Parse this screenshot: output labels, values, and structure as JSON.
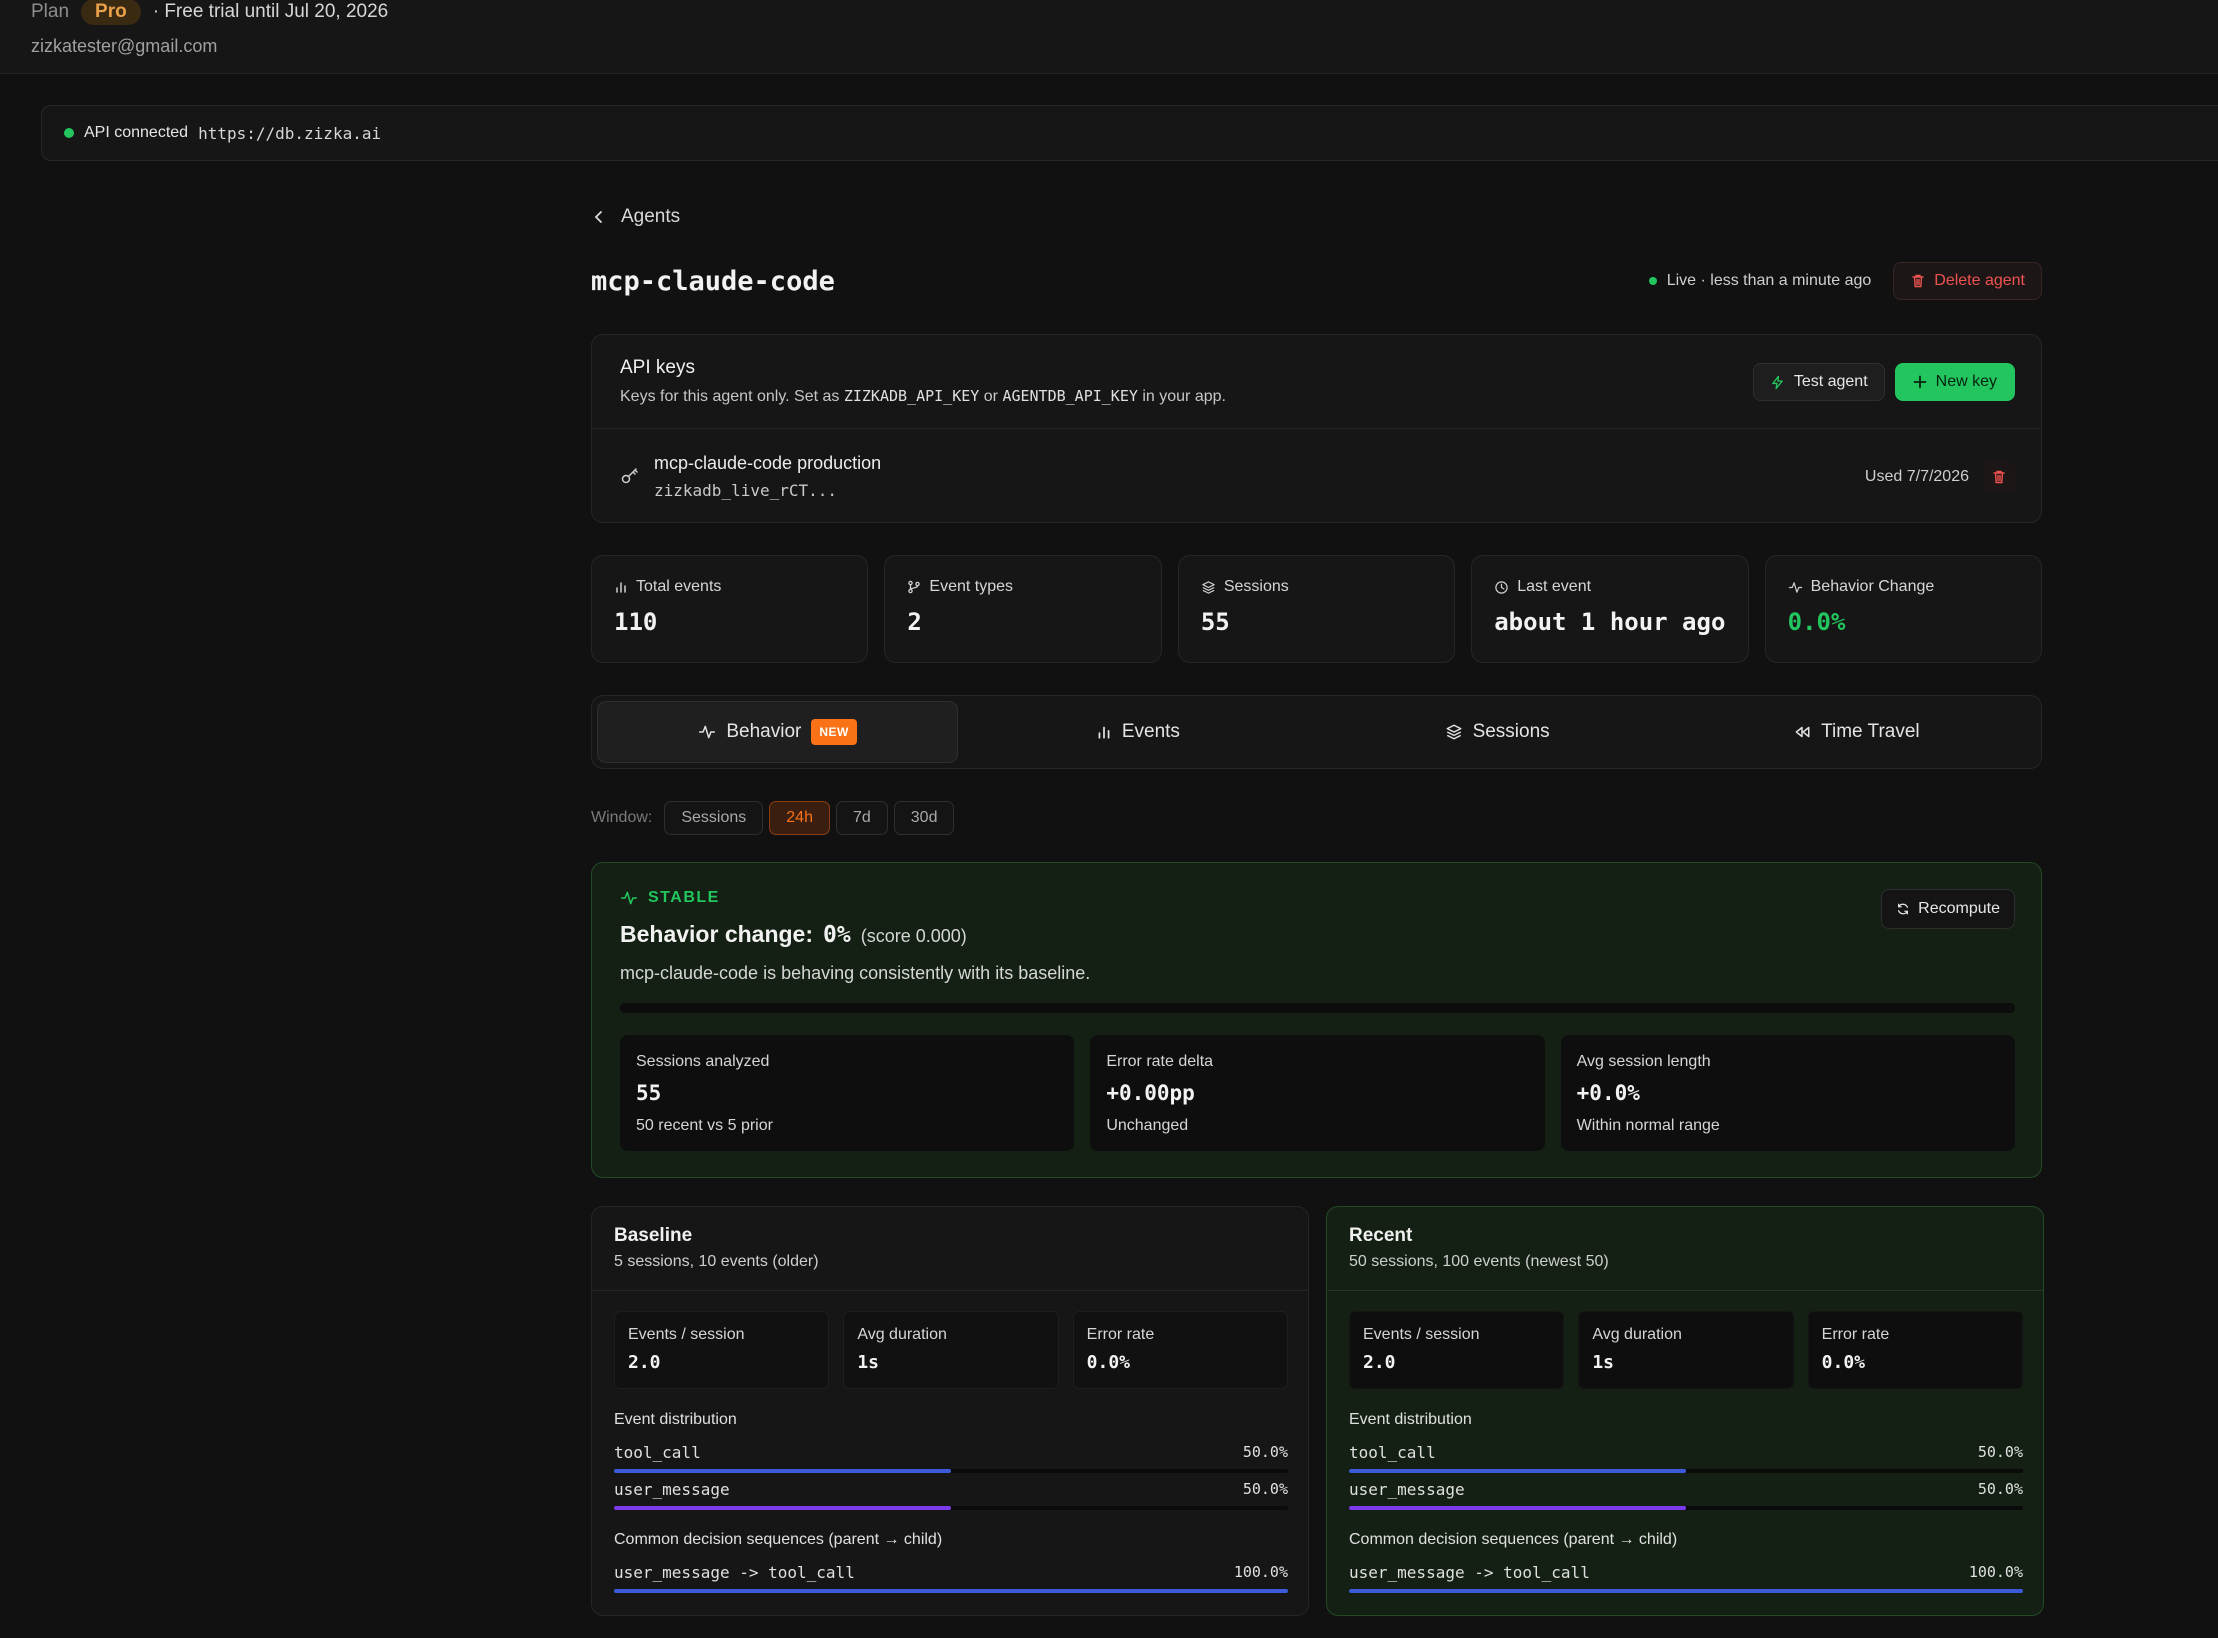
{
  "header": {
    "plan_label": "Plan",
    "plan_badge": "Pro",
    "trial": "· Free trial until Jul 20, 2026",
    "email": "zizkatester@gmail.com"
  },
  "api_status": {
    "label": "API connected",
    "url": "https://db.zizka.ai"
  },
  "nav": {
    "back_label": "Agents"
  },
  "agent": {
    "name": "mcp-claude-code",
    "live_status": "Live · less than a minute ago",
    "delete_label": "Delete agent"
  },
  "api_keys": {
    "title": "API keys",
    "desc_prefix": "Keys for this agent only. Set as",
    "env1": "ZIZKADB_API_KEY",
    "desc_or": "or",
    "env2": "AGENTDB_API_KEY",
    "desc_suffix": "in your app.",
    "test_label": "Test agent",
    "new_key_label": "New key",
    "keys": [
      {
        "name": "mcp-claude-code production",
        "value": "zizkadb_live_rCT...",
        "used": "Used 7/7/2026"
      }
    ]
  },
  "stats": [
    {
      "label": "Total events",
      "value": "110",
      "icon": "bar-chart-icon"
    },
    {
      "label": "Event types",
      "value": "2",
      "icon": "branch-icon"
    },
    {
      "label": "Sessions",
      "value": "55",
      "icon": "layers-icon"
    },
    {
      "label": "Last event",
      "value": "about 1 hour ago",
      "icon": "clock-icon"
    },
    {
      "label": "Behavior Change",
      "value": "0.0%",
      "icon": "activity-icon"
    }
  ],
  "tabs": [
    {
      "label": "Behavior",
      "badge": "NEW",
      "active": true
    },
    {
      "label": "Events"
    },
    {
      "label": "Sessions"
    },
    {
      "label": "Time Travel"
    }
  ],
  "window": {
    "label": "Window:",
    "options": [
      "Sessions",
      "24h",
      "7d",
      "30d"
    ],
    "selected": "24h"
  },
  "behavior": {
    "status": "STABLE",
    "recompute_label": "Recompute",
    "title": "Behavior change:",
    "value": "0%",
    "score": "(score 0.000)",
    "description": "mcp-claude-code is behaving consistently with its baseline.",
    "change_fraction": 0,
    "metrics": [
      {
        "label": "Sessions analyzed",
        "value": "55",
        "sub": "50 recent vs 5 prior"
      },
      {
        "label": "Error rate delta",
        "value": "+0.00pp",
        "sub": "Unchanged"
      },
      {
        "label": "Avg session length",
        "value": "+0.0%",
        "sub": "Within normal range"
      }
    ]
  },
  "baseline": {
    "title": "Baseline",
    "subtitle": "5 sessions, 10 events (older)",
    "metrics": [
      {
        "label": "Events / session",
        "value": "2.0"
      },
      {
        "label": "Avg duration",
        "value": "1s"
      },
      {
        "label": "Error rate",
        "value": "0.0%"
      }
    ],
    "dist_label": "Event distribution",
    "distribution": [
      {
        "name": "tool_call",
        "pct": "50.0%",
        "fraction": 0.5,
        "color": "#3b5bdb"
      },
      {
        "name": "user_message",
        "pct": "50.0%",
        "fraction": 0.5,
        "color": "#7c3aed"
      }
    ],
    "seq_label": "Common decision sequences (parent → child)",
    "sequences": [
      {
        "name": "user_message -> tool_call",
        "pct": "100.0%",
        "fraction": 1.0,
        "color": "#3b5bdb"
      }
    ]
  },
  "recent": {
    "title": "Recent",
    "subtitle": "50 sessions, 100 events (newest 50)",
    "metrics": [
      {
        "label": "Events / session",
        "value": "2.0"
      },
      {
        "label": "Avg duration",
        "value": "1s"
      },
      {
        "label": "Error rate",
        "value": "0.0%"
      }
    ],
    "dist_label": "Event distribution",
    "distribution": [
      {
        "name": "tool_call",
        "pct": "50.0%",
        "fraction": 0.5,
        "color": "#3b5bdb"
      },
      {
        "name": "user_message",
        "pct": "50.0%",
        "fraction": 0.5,
        "color": "#7c3aed"
      }
    ],
    "seq_label": "Common decision sequences (parent → child)",
    "sequences": [
      {
        "name": "user_message -> tool_call",
        "pct": "100.0%",
        "fraction": 1.0,
        "color": "#3b5bdb"
      }
    ]
  }
}
